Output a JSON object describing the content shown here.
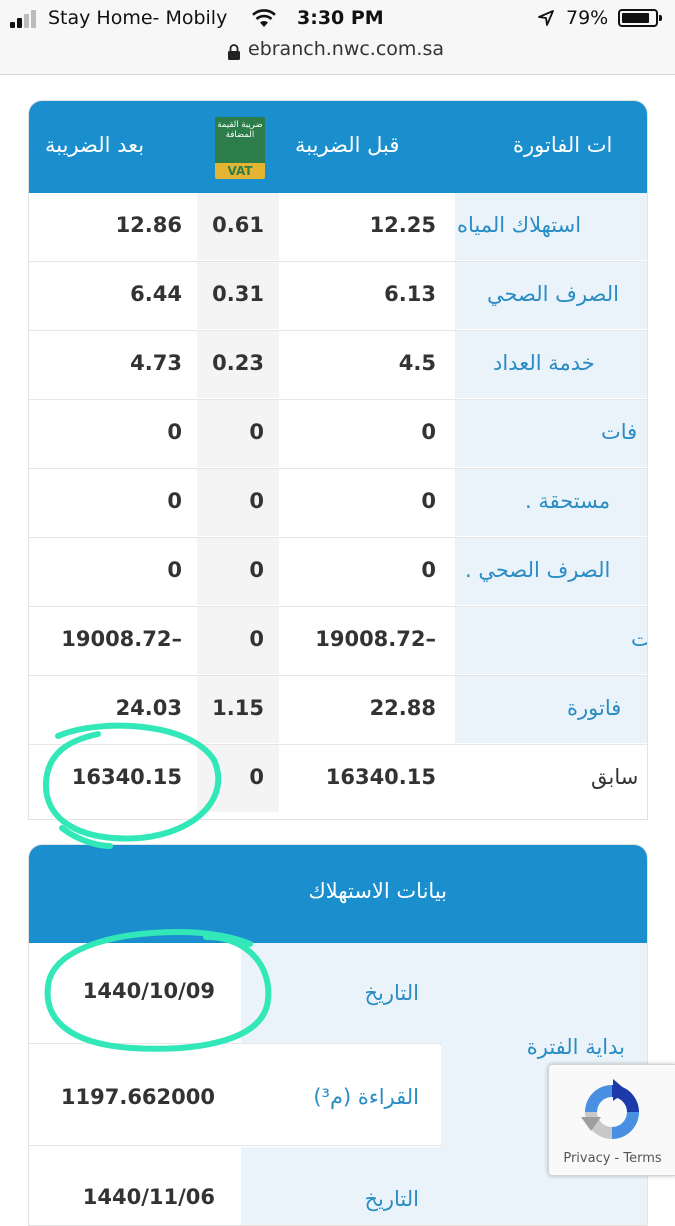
{
  "status_bar": {
    "carrier": "Stay Home- Mobily",
    "time": "3:30 PM",
    "battery": "79%"
  },
  "browser": {
    "url": "ebranch.nwc.com.sa"
  },
  "bill_table": {
    "headers": {
      "item": "ات الفاتورة",
      "before_tax": "قبل الضريبة",
      "vat_logo_arabic": "ضريبة القيمة المضافة",
      "vat_logo_text": "VAT",
      "after_tax": "بعد الضريبة"
    },
    "rows": [
      {
        "label": "استهلاك المياه",
        "before": "12.25",
        "tax": "0.61",
        "after": "12.86"
      },
      {
        "label": "الصرف الصحي",
        "before": "6.13",
        "tax": "0.31",
        "after": "6.44"
      },
      {
        "label": "خدمة العداد",
        "before": "4.5",
        "tax": "0.23",
        "after": "4.73"
      },
      {
        "label": "فات",
        "before": "0",
        "tax": "0",
        "after": "0"
      },
      {
        "label": ". مستحقة",
        "before": "0",
        "tax": "0",
        "after": "0"
      },
      {
        "label": ". الصرف الصحي",
        "before": "0",
        "tax": "0",
        "after": "0"
      },
      {
        "label": "ت",
        "before": "19008.72–",
        "tax": "0",
        "after": "19008.72–"
      },
      {
        "label": "فاتورة",
        "before": "22.88",
        "tax": "1.15",
        "after": "24.03"
      },
      {
        "label": "سابق",
        "before": "16340.15",
        "tax": "0",
        "after": "16340.15"
      }
    ]
  },
  "consumption_table": {
    "title": "بيانات الاستهلاك",
    "period_start": "بداية الفترة",
    "date_label": "التاريخ",
    "date_value": "1440/10/09",
    "reading_label": "القراءة (م³)",
    "reading_value": "1197.662000",
    "date_label_2": "التاريخ",
    "date_value_2": "1440/11/06"
  },
  "recaptcha": {
    "terms": "Privacy - Terms"
  },
  "colors": {
    "header_blue": "#1b8fce",
    "label_blue": "#2a8cc4",
    "highlight_circle": "#33e8b8"
  }
}
